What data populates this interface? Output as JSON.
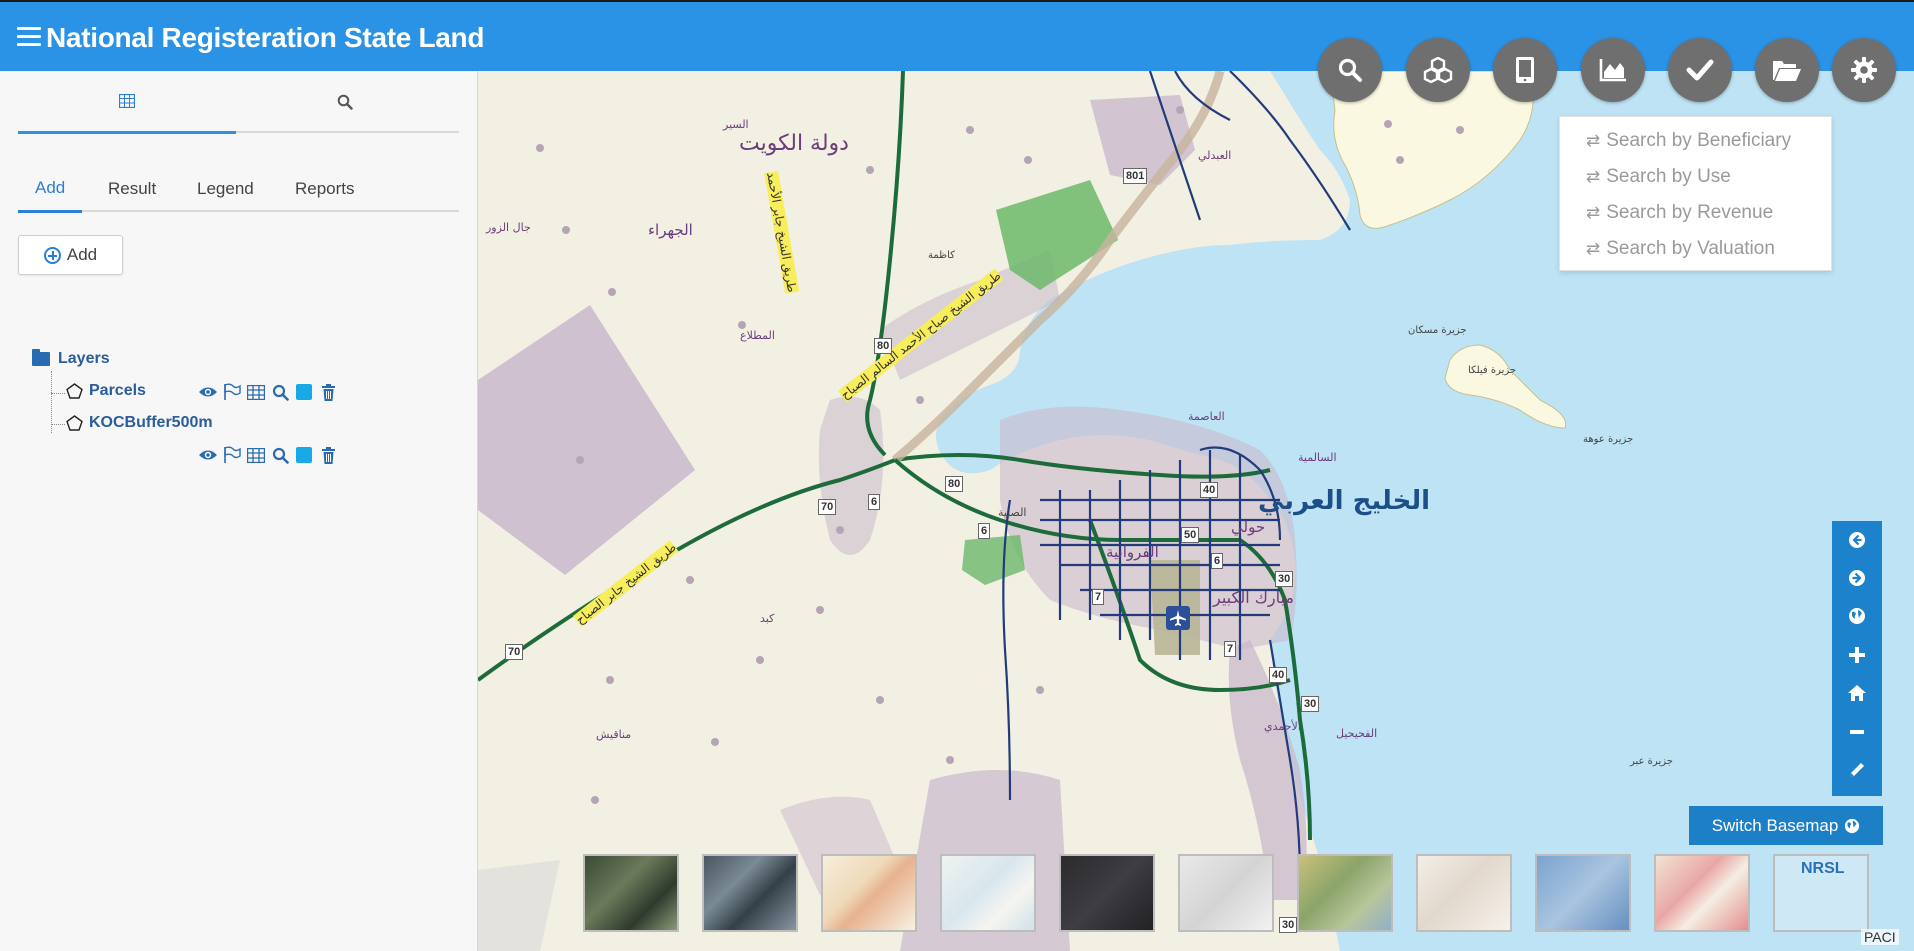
{
  "app": {
    "title": "National Registeration State Land"
  },
  "sidebar": {
    "top_tabs": [
      {
        "icon": "table-icon",
        "active": true
      },
      {
        "icon": "search-icon",
        "active": false
      }
    ],
    "sub_tabs": [
      {
        "label": "Add",
        "active": true
      },
      {
        "label": "Result",
        "active": false
      },
      {
        "label": "Legend",
        "active": false
      },
      {
        "label": "Reports",
        "active": false
      }
    ],
    "add_button": "Add",
    "tree": {
      "root_label": "Layers",
      "layers": [
        {
          "name": "Parcels"
        },
        {
          "name": "KOCBuffer500m"
        }
      ]
    }
  },
  "toolbar": {
    "buttons": [
      "search-icon",
      "cubes-icon",
      "tablet-icon",
      "area-chart-icon",
      "check-icon",
      "folder-open-icon",
      "gear-icon"
    ]
  },
  "search_menu": {
    "items": [
      "Search by Beneficiary",
      "Search by Use",
      "Search by Revenue",
      "Search by Valuation"
    ]
  },
  "map": {
    "labels": {
      "country": "دولة الكويت",
      "gulf": "الخليج العربي",
      "jahra": "الجهراء",
      "asima": "العاصمة",
      "farwaniya": "الفروانية",
      "hawalli": "حولي",
      "mubarak": "مبارك الكبير",
      "ahmadi": "الأحمدي",
      "salmiya": "السالمية",
      "fuhaihil": "الفحيحيل",
      "mutlaa": "المطلاع",
      "kabd": "كبد",
      "manaqish": "مناقيش",
      "failaka": "جزيرة فيلكا",
      "kazma": "كاظمة",
      "abdali": "العبدلي",
      "subiya": "الصبية",
      "sir": "السير",
      "jal": "جال الزور",
      "awha": "جزيرة عوهة",
      "mashkan": "جزيرة مسكان",
      "kubbar": "جزيرة عبر",
      "jahra_road": "طريق الشيخ جابر الأحمد",
      "road_label": "طريق الشيخ صباح الأحمد السالم الصباح",
      "road_label2": "طريق الشيخ جابر الصباح"
    },
    "route_numbers": [
      "801",
      "80",
      "70",
      "6",
      "80",
      "6",
      "40",
      "50",
      "6",
      "30",
      "7",
      "7",
      "40",
      "30",
      "70",
      "30"
    ],
    "nav_buttons": [
      "arrow-left-circle-icon",
      "arrow-right-circle-icon",
      "globe-icon",
      "zoom-in-icon",
      "home-icon",
      "zoom-out-icon",
      "pencil-icon"
    ],
    "switch_basemap": "Switch Basemap",
    "basemaps": [
      {
        "name": "imagery"
      },
      {
        "name": "imagery-labels"
      },
      {
        "name": "streets"
      },
      {
        "name": "topographic"
      },
      {
        "name": "dark-gray"
      },
      {
        "name": "light-gray"
      },
      {
        "name": "national-geographic"
      },
      {
        "name": "terrain"
      },
      {
        "name": "oceans"
      },
      {
        "name": "openstreetmap"
      },
      {
        "name": "nrsl",
        "label": "NRSL"
      }
    ],
    "attribution": "PACI"
  },
  "colors": {
    "header": "#2b93e6",
    "accent": "#2b7fd4",
    "sea": "#bde3f5",
    "land": "#f2efe3",
    "urban": "#c9b9cc",
    "road_green": "#1d6b3a",
    "road_navy": "#233b7a",
    "nav_strip": "#1c82cc"
  }
}
